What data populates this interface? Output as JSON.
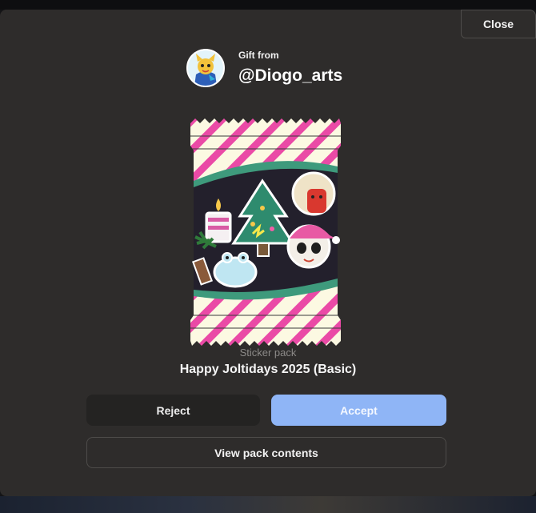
{
  "dialog": {
    "close_label": "Close",
    "gift_from_label": "Gift from",
    "sender": "@Diogo_arts",
    "pack_type": "Sticker pack",
    "pack_title": "Happy Joltidays 2025 (Basic)",
    "reject_label": "Reject",
    "accept_label": "Accept",
    "view_contents_label": "View pack contents"
  },
  "colors": {
    "modal_bg": "#2e2c2b",
    "accept_bg": "#8fb5f6",
    "reject_bg": "#242322",
    "wrapper_stripe": "#ea4aa6",
    "wrapper_base": "#fcf9e2",
    "band_green": "#3e9a7c"
  },
  "icons": {
    "avatar": "sender-avatar",
    "stickers": [
      "candle-icon",
      "christmas-tree-icon",
      "red-mask-icon",
      "panda-santa-icon",
      "frog-snowman-icon",
      "pine-branch-icon"
    ]
  }
}
